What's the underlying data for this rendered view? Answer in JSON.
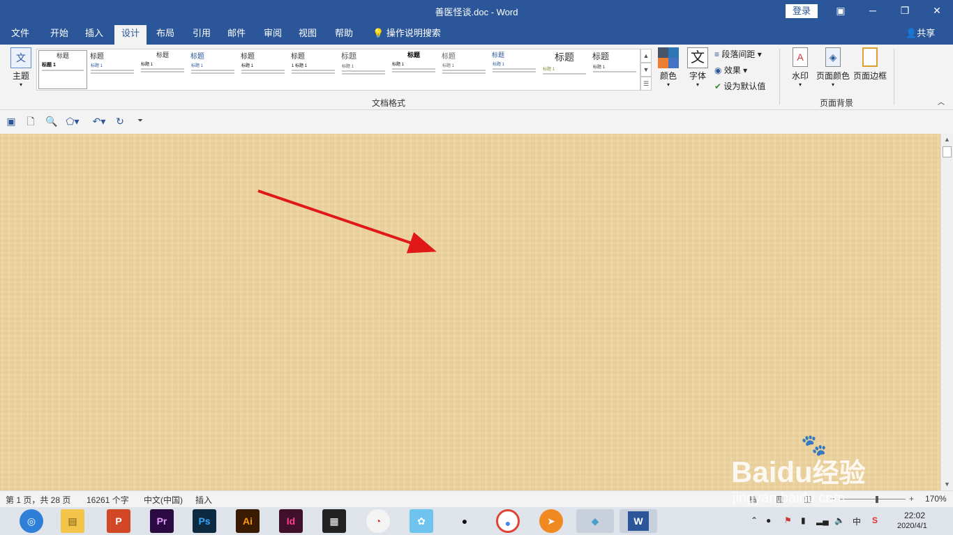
{
  "window": {
    "title": "善医怪谈.doc  -  Word",
    "signin": "登录"
  },
  "tabs": [
    "文件",
    "开始",
    "插入",
    "设计",
    "布局",
    "引用",
    "邮件",
    "审阅",
    "视图",
    "帮助"
  ],
  "tellme": "操作说明搜索",
  "share": "共享",
  "ribbon": {
    "theme_label": "主题",
    "gallery": [
      {
        "h": "标题",
        "sub": "标题 1"
      },
      {
        "h": "标题",
        "sub": "标题 1"
      },
      {
        "h": "标题",
        "sub": "标题 1"
      },
      {
        "h": "标题",
        "sub": "标题 1"
      },
      {
        "h": "标题",
        "sub": "标题 1"
      },
      {
        "h": "标题",
        "sub": "1 标题 1"
      },
      {
        "h": "标题",
        "sub": "标题 1"
      },
      {
        "h": "标题",
        "sub": "标题 1"
      },
      {
        "h": "标题",
        "sub": "标题 1"
      },
      {
        "h": "标题",
        "sub": "标题 1"
      },
      {
        "h": "标题",
        "sub": "标题 1"
      },
      {
        "h": "标题",
        "sub": "标题 1"
      }
    ],
    "colors_label": "颜色",
    "fonts_label": "字体",
    "paragraph_spacing": "段落间距",
    "effects": "效果",
    "set_default": "设为默认值",
    "group_doc_format": "文档格式",
    "watermark": "水印",
    "page_color": "页面颜色",
    "page_borders": "页面边框",
    "group_page_bg": "页面背景"
  },
  "status": {
    "page": "第 1 页，共 28 页",
    "words": "16261 个字",
    "lang": "中文(中国)",
    "mode": "插入",
    "zoom": "170%"
  },
  "taskbar": {
    "time": "22:02",
    "date": "2020/4/1",
    "ime": "中"
  },
  "watermark": {
    "brand": "Bai",
    "brand2": "du",
    "cn": "经验",
    "url": "jingyan.baidu.com"
  }
}
